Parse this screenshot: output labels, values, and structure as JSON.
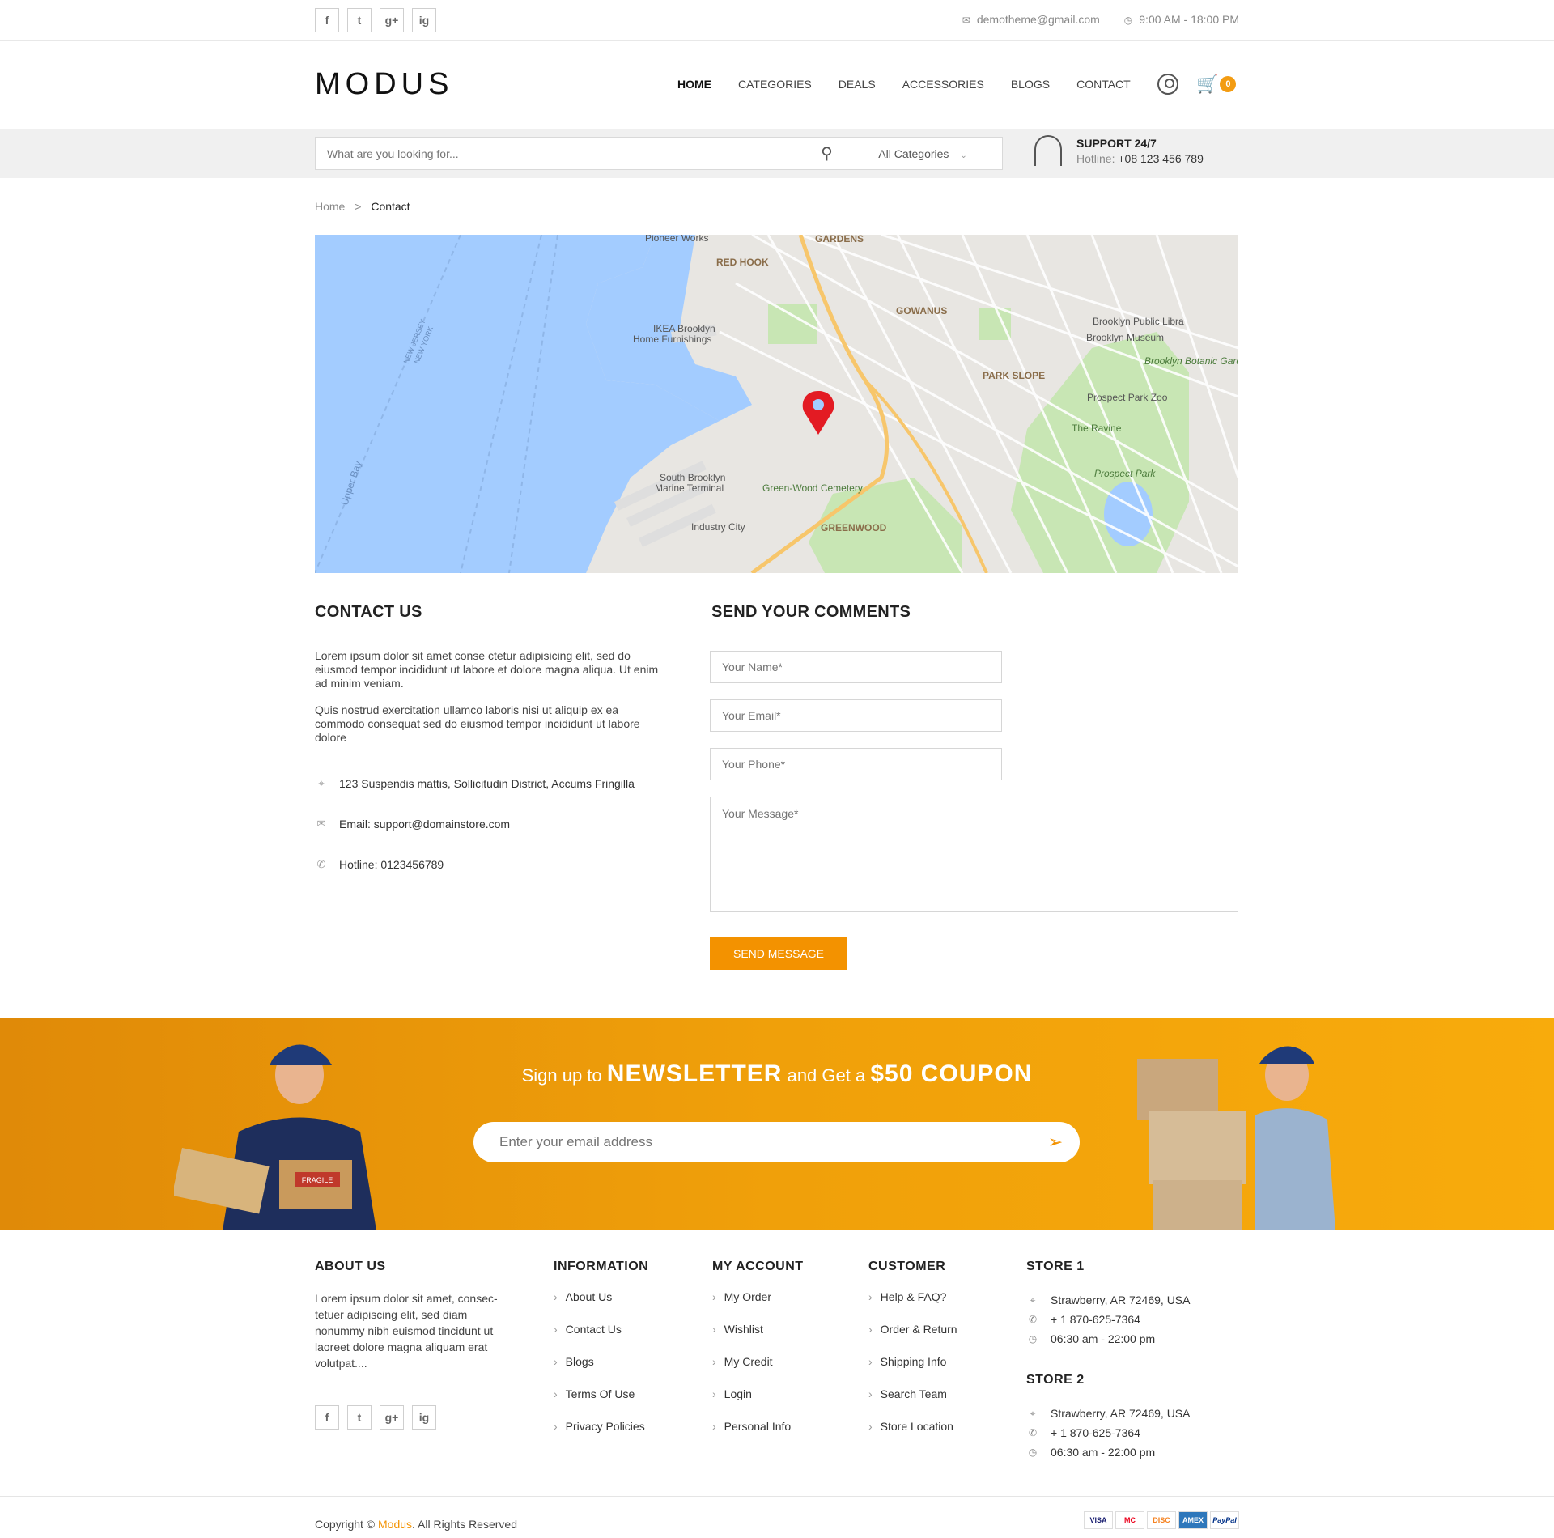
{
  "topbar": {
    "social": [
      "f",
      "t",
      "g+",
      "ig"
    ],
    "email": "demotheme@gmail.com",
    "hours": "9:00 AM - 18:00 PM"
  },
  "header": {
    "logo": "MODUS",
    "nav": [
      "HOME",
      "CATEGORIES",
      "DEALS",
      "ACCESSORIES",
      "BLOGS",
      "CONTACT"
    ],
    "cart_count": "0"
  },
  "search": {
    "placeholder": "What are you looking for...",
    "category": "All Categories"
  },
  "support": {
    "title": "SUPPORT 24/7",
    "hotline_label": "Hotline:",
    "hotline": "+08 123 456 789"
  },
  "breadcrumb": {
    "home": "Home",
    "sep": ">",
    "current": "Contact"
  },
  "map": {
    "labels": [
      "Pioneer Works",
      "GARDENS",
      "RED HOOK",
      "GOWANUS",
      "IKEA Brooklyn",
      "Home Furnishings",
      "Brooklyn Public Libra",
      "Brooklyn Museum",
      "Brooklyn Botanic Garden",
      "PARK SLOPE",
      "Prospect Park Zoo",
      "The Ravine",
      "Prospect Park",
      "South Brooklyn",
      "Marine Terminal",
      "Green-Wood Cemetery",
      "Industry City",
      "GREENWOOD",
      "Upper Bay",
      "NEW JERSEY",
      "NEW YORK"
    ]
  },
  "contact": {
    "title": "CONTACT US",
    "para1": "Lorem ipsum dolor sit amet conse ctetur adipisicing elit, sed do eiusmod tempor incididunt ut labore et dolore magna aliqua. Ut enim ad minim veniam.",
    "para2": "Quis nostrud exercitation ullamco laboris nisi ut aliquip ex ea commodo consequat sed do eiusmod tempor incididunt ut labore dolore",
    "address": "123 Suspendis mattis, Sollicitudin District, Accums Fringilla",
    "email": "Email: support@domainstore.com",
    "hotline": "Hotline: 0123456789"
  },
  "form": {
    "title": "SEND YOUR COMMENTS",
    "name_placeholder": "Your Name*",
    "email_placeholder": "Your Email*",
    "phone_placeholder": "Your Phone*",
    "message_placeholder": "Your Message*",
    "submit": "SEND MESSAGE"
  },
  "newsletter": {
    "t1": "Sign up to",
    "t2": "NEWSLETTER",
    "t3": "and Get a",
    "t4": "$50 COUPON",
    "placeholder": "Enter your email address",
    "box_text": "FRAGILE"
  },
  "footer": {
    "about_title": "ABOUT US",
    "about_text": "Lorem ipsum dolor sit amet, consec-tetuer adipiscing elit, sed diam nonummy nibh euismod tincidunt ut laoreet dolore magna aliquam erat volutpat....",
    "info_title": "INFORMATION",
    "info_links": [
      "About Us",
      "Contact Us",
      "Blogs",
      "Terms Of Use",
      "Privacy Policies"
    ],
    "account_title": "MY ACCOUNT",
    "account_links": [
      "My Order",
      "Wishlist",
      "My Credit",
      "Login",
      "Personal Info"
    ],
    "customer_title": "CUSTOMER",
    "customer_links": [
      "Help & FAQ?",
      "Order & Return",
      "Shipping Info",
      "Search Team",
      "Store Location"
    ],
    "stores": [
      {
        "title": "STORE 1",
        "address": "Strawberry, AR 72469, USA",
        "phone": "+ 1 870-625-7364",
        "hours": "06:30 am - 22:00 pm"
      },
      {
        "title": "STORE 2",
        "address": "Strawberry, AR 72469, USA",
        "phone": "+ 1 870-625-7364",
        "hours": "06:30 am - 22:00 pm"
      }
    ]
  },
  "bottom": {
    "copy_pre": "Copyright ©",
    "brand": "Modus",
    "copy_post": ". All Rights Reserved",
    "payments": [
      "VISA",
      "MC",
      "DISC",
      "AMEX",
      "PayPal"
    ]
  },
  "colors": {
    "accent": "#f39200",
    "water": "#a3ccff",
    "park": "#c8e6b4"
  }
}
